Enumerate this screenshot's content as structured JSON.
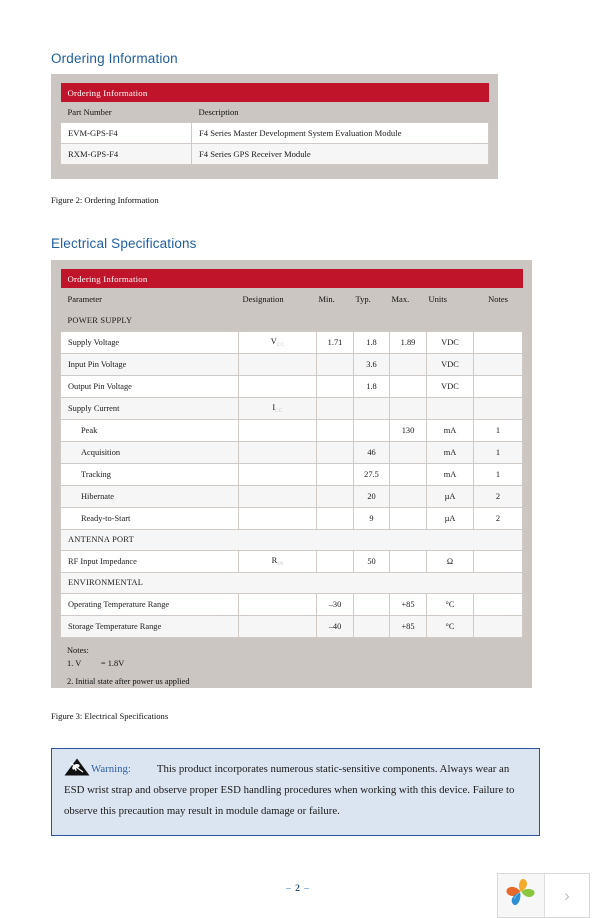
{
  "document": {
    "page_number": "2",
    "page_number_prefix": "–",
    "page_number_suffix": "–"
  },
  "sections": {
    "ordering": {
      "heading": "Ordering Information",
      "caption": "Figure 2: Ordering Information",
      "table": {
        "title": "Ordering Information",
        "columns": [
          "Part Number",
          "Description"
        ],
        "rows": [
          [
            "EVM-GPS-F4",
            "F4 Series Master Development System Evaluation Module"
          ],
          [
            "RXM-GPS-F4",
            "F4 Series GPS Receiver Module"
          ]
        ]
      }
    },
    "electrical": {
      "heading": "Electrical Specifications",
      "caption": "Figure 3: Electrical Specifications",
      "table": {
        "title": "Ordering Information",
        "columns": [
          "Parameter",
          "Designation",
          "Min.",
          "Typ.",
          "Max.",
          "Units",
          "Notes"
        ],
        "groups": [
          {
            "name": "POWER SUPPLY",
            "rows": [
              {
                "parameter": "Supply Voltage",
                "indent": false,
                "designation": "V",
                "designation_sub": "CC",
                "min": "1.71",
                "typ": "1.8",
                "max": "1.89",
                "units": "VDC",
                "notes": ""
              },
              {
                "parameter": "Input Pin Voltage",
                "indent": false,
                "designation": "",
                "designation_sub": "",
                "min": "",
                "typ": "3.6",
                "max": "",
                "units": "VDC",
                "notes": ""
              },
              {
                "parameter": "Output Pin Voltage",
                "indent": false,
                "designation": "",
                "designation_sub": "",
                "min": "",
                "typ": "1.8",
                "max": "",
                "units": "VDC",
                "notes": ""
              },
              {
                "parameter": "Supply Current",
                "indent": false,
                "designation": "I",
                "designation_sub": "CC",
                "min": "",
                "typ": "",
                "max": "",
                "units": "",
                "notes": ""
              },
              {
                "parameter": "Peak",
                "indent": true,
                "designation": "",
                "designation_sub": "",
                "min": "",
                "typ": "",
                "max": "130",
                "units": "mA",
                "notes": "1"
              },
              {
                "parameter": "Acquisition",
                "indent": true,
                "designation": "",
                "designation_sub": "",
                "min": "",
                "typ": "46",
                "max": "",
                "units": "mA",
                "notes": "1"
              },
              {
                "parameter": "Tracking",
                "indent": true,
                "designation": "",
                "designation_sub": "",
                "min": "",
                "typ": "27.5",
                "max": "",
                "units": "mA",
                "notes": "1"
              },
              {
                "parameter": "Hibernate",
                "indent": true,
                "designation": "",
                "designation_sub": "",
                "min": "",
                "typ": "20",
                "max": "",
                "units": "µA",
                "notes": "2"
              },
              {
                "parameter": "Ready-to-Start",
                "indent": true,
                "designation": "",
                "designation_sub": "",
                "min": "",
                "typ": "9",
                "max": "",
                "units": "µA",
                "notes": "2"
              }
            ]
          },
          {
            "name": "ANTENNA PORT",
            "rows": [
              {
                "parameter": "RF Input Impedance",
                "indent": false,
                "designation": "R",
                "designation_sub": "IN",
                "min": "",
                "typ": "50",
                "max": "",
                "units": "Ω",
                "notes": ""
              }
            ]
          },
          {
            "name": "ENVIRONMENTAL",
            "rows": [
              {
                "parameter": "Operating Temperature Range",
                "indent": false,
                "designation": "",
                "designation_sub": "",
                "min": "–30",
                "typ": "",
                "max": "+85",
                "units": "°C",
                "notes": ""
              },
              {
                "parameter": "Storage Temperature Range",
                "indent": false,
                "designation": "",
                "designation_sub": "",
                "min": "–40",
                "typ": "",
                "max": "+85",
                "units": "°C",
                "notes": ""
              }
            ]
          }
        ],
        "notes": {
          "title": "Notes:",
          "items": [
            {
              "number": "1.",
              "prefix": "V",
              "sub": "CC",
              "text": "= 1.8V"
            },
            {
              "number": "2.",
              "prefix": "",
              "sub": "",
              "text": "Initial state after power us applied"
            }
          ]
        }
      }
    }
  },
  "warning": {
    "icon": "esd-warning-icon",
    "label": "Warning:",
    "body": "This product incorporates numerous static-sensitive components. Always wear an ESD wrist strap and observe proper ESD handling procedures when working with this device. Failure to observe this precaution may result in module damage or failure."
  },
  "footer": {
    "logo_alt": "brand-leaf-logo",
    "next_label": "›"
  },
  "colors": {
    "heading_blue": "#1f5fa0",
    "table_red": "#bf1429",
    "frame_gray": "#ccc6c2",
    "warning_bg": "#dbe5f1",
    "warning_border": "#2f5496",
    "warning_label": "#2f5fa8"
  }
}
